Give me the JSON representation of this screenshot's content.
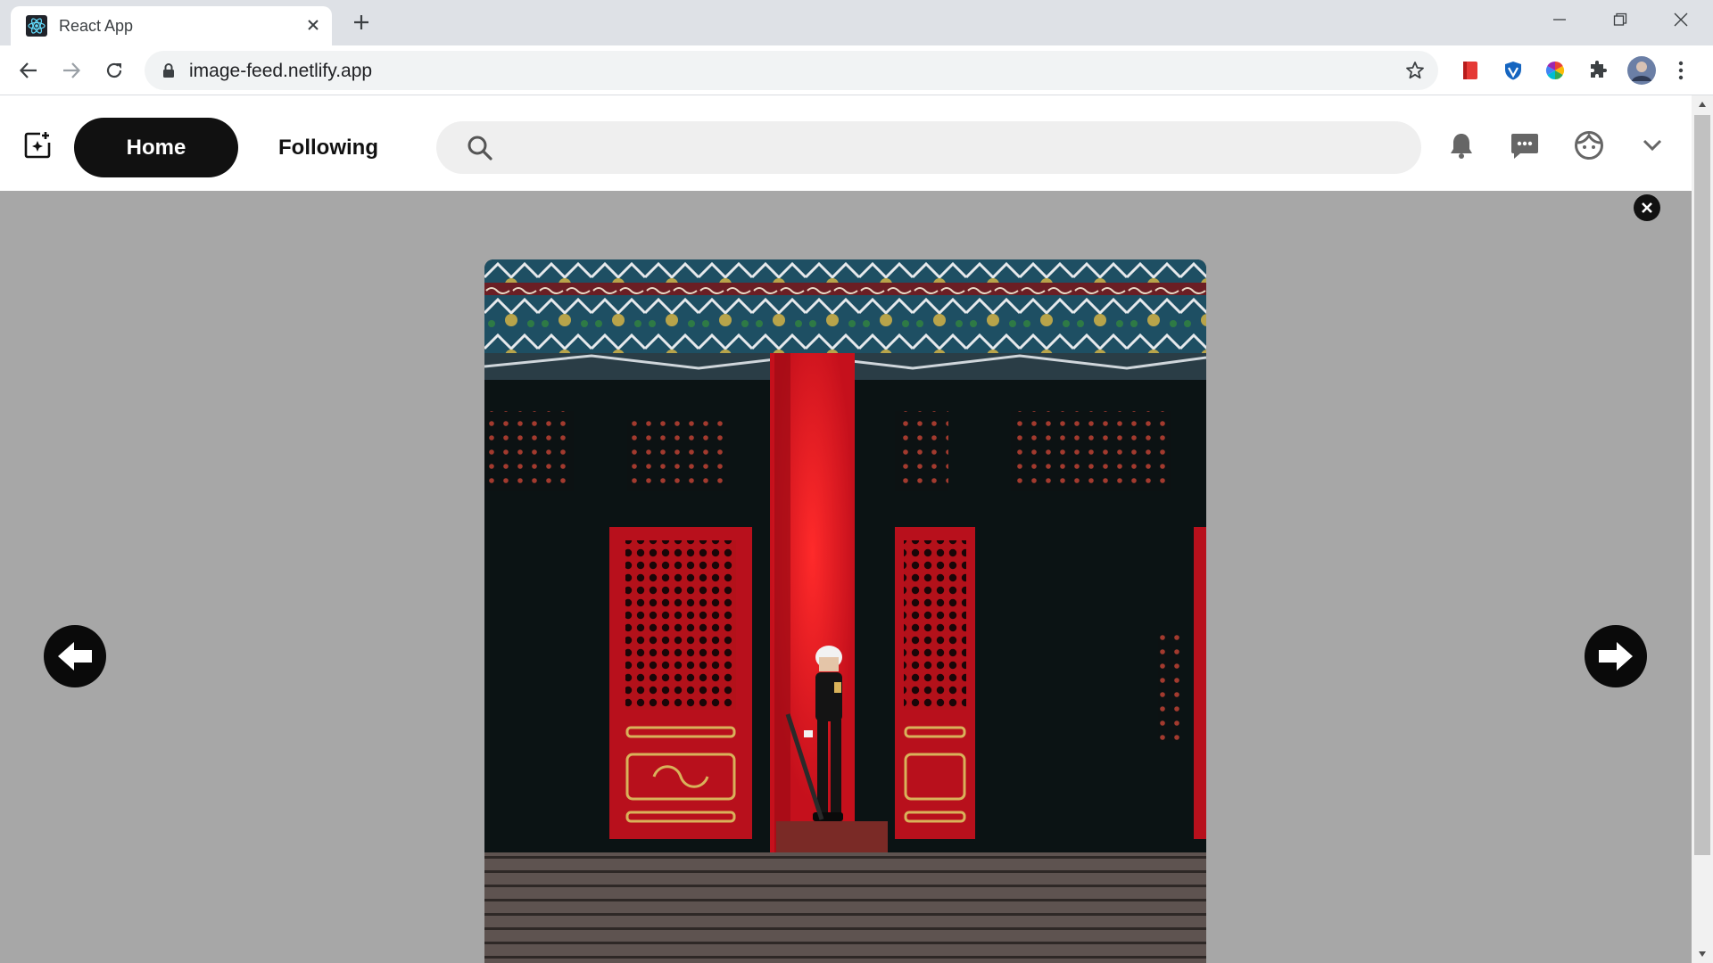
{
  "browser": {
    "tab": {
      "title": "React App",
      "favicon": "react-atom-icon"
    },
    "address_bar": {
      "url": "image-feed.netlify.app"
    },
    "extensions": [
      "bookmark-extension-icon",
      "shield-extension-icon",
      "color-wheel-extension-icon",
      "puzzle-extensions-icon",
      "profile-avatar"
    ]
  },
  "app": {
    "nav": {
      "home_label": "Home",
      "following_label": "Following"
    },
    "search": {
      "placeholder": ""
    },
    "icons": [
      "bell-icon",
      "chat-icon",
      "face-icon",
      "chevron-down-icon"
    ],
    "viewer": {
      "photo_subject": "guard-in-front-of-red-palace-doors",
      "prev_icon": "arrow-left-icon",
      "next_icon": "arrow-right-icon",
      "close_icon": "close-icon"
    }
  },
  "colors": {
    "overlay": "#a7a7a7",
    "active_tab": "#111111",
    "search_bg": "#efefef"
  }
}
